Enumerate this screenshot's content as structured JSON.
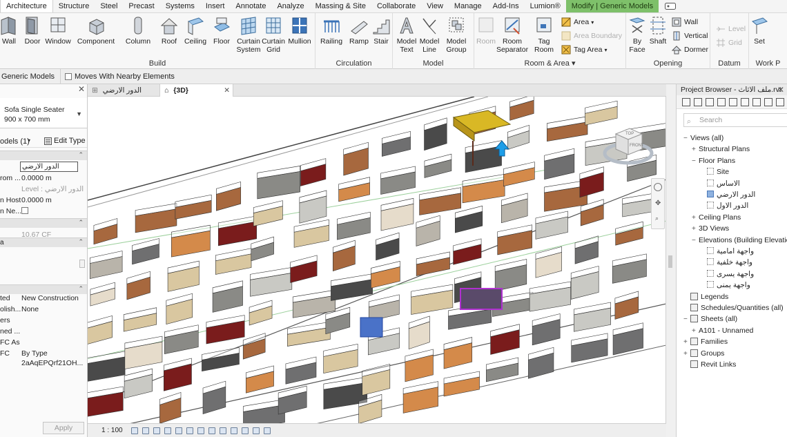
{
  "ribbon_tabs": [
    "Architecture",
    "Structure",
    "Steel",
    "Precast",
    "Systems",
    "Insert",
    "Annotate",
    "Analyze",
    "Massing & Site",
    "Collaborate",
    "View",
    "Manage",
    "Add-Ins",
    "Lumion®"
  ],
  "contextual_tab": "Modify | Generic Models",
  "panels": {
    "build": "Build",
    "circulation": "Circulation",
    "model": "Model",
    "room_area": "Room & Area ▾",
    "opening": "Opening",
    "datum": "Datum",
    "work_plane": "Work P"
  },
  "tools": {
    "wall": "Wall",
    "door": "Door",
    "window": "Window",
    "component": "Component",
    "column": "Column",
    "roof": "Roof",
    "ceiling": "Ceiling",
    "floor": "Floor",
    "curtain_system": "Curtain System",
    "curtain_grid": "Curtain Grid",
    "mullion": "Mullion",
    "railing": "Railing",
    "ramp": "Ramp",
    "stair": "Stair",
    "model_text": "Model Text",
    "model_line": "Model Line",
    "model_group": "Model Group",
    "room": "Room",
    "room_separator": "Room Separator",
    "tag_room": "Tag Room",
    "area": "Area",
    "area_boundary": "Area Boundary",
    "tag_area": "Tag Area",
    "by_face": "By Face",
    "shaft": "Shaft",
    "wall_opening": "Wall",
    "vertical": "Vertical",
    "dormer": "Dormer",
    "level": "Level",
    "grid": "Grid",
    "set": "Set"
  },
  "options_bar": {
    "context": "Generic Models",
    "moves_with_nearby": "Moves With Nearby Elements"
  },
  "properties": {
    "type_name": "Sofa Single Seater",
    "type_size": "900 x 700 mm",
    "instance_filter": "odels (1)",
    "edit_type": "Edit Type",
    "level_value": "الدور الارضي",
    "rows": [
      {
        "k": "rom ...",
        "v": "0.0000 m"
      },
      {
        "k": "",
        "v": "Level : الدور الارضي"
      },
      {
        "k": "n Host",
        "v": "0.0000 m"
      },
      {
        "k": "n Ne...",
        "v": ""
      }
    ],
    "volume": "10.67 CF",
    "phase_created_k": "ted",
    "phase_created_v": "New Construction",
    "phase_demo_k": "olish...",
    "phase_demo_v": "None",
    "ifc_k": "ers",
    "ifc_row2_k": "ned ...",
    "ifc_row3_k": "FC As",
    "ifc_row4_k": "FC",
    "ifc_row4_v": "By Type",
    "ifc_guid": "2aAqEPQrf21OH...",
    "group_a": "a",
    "apply": "Apply"
  },
  "view_tabs": [
    {
      "label": "الدور الارضي"
    },
    {
      "label": "{3D}"
    }
  ],
  "view_scale": "1 : 100",
  "browser": {
    "title": "Project Browser - ملف الاثاث.rvt",
    "search_placeholder": "Search",
    "tree": [
      {
        "label": "Views (all)",
        "level": 0,
        "toggle": "−"
      },
      {
        "label": "Structural Plans",
        "level": 1,
        "toggle": "+"
      },
      {
        "label": "Floor Plans",
        "level": 1,
        "toggle": "−"
      },
      {
        "label": "Site",
        "level": 2,
        "box": true
      },
      {
        "label": "الاساس",
        "level": 2,
        "box": true,
        "rtl": true
      },
      {
        "label": "الدور الارضي",
        "level": 2,
        "box": true,
        "rtl": true,
        "selected": true
      },
      {
        "label": "الدور الاول",
        "level": 2,
        "box": true,
        "rtl": true
      },
      {
        "label": "Ceiling Plans",
        "level": 1,
        "toggle": "+"
      },
      {
        "label": "3D Views",
        "level": 1,
        "toggle": "+"
      },
      {
        "label": "Elevations (Building Elevation)",
        "level": 1,
        "toggle": "−"
      },
      {
        "label": "واجهة امامية",
        "level": 2,
        "box": true,
        "rtl": true
      },
      {
        "label": "واجهة خلفية",
        "level": 2,
        "box": true,
        "rtl": true
      },
      {
        "label": "واجهة يسرى",
        "level": 2,
        "box": true,
        "rtl": true
      },
      {
        "label": "واجهة يمنى",
        "level": 2,
        "box": true,
        "rtl": true
      },
      {
        "label": "Legends",
        "level": 0,
        "icon": true
      },
      {
        "label": "Schedules/Quantities (all)",
        "level": 0,
        "icon": true
      },
      {
        "label": "Sheets (all)",
        "level": 0,
        "toggle": "−",
        "icon": true
      },
      {
        "label": "A101 - Unnamed",
        "level": 1,
        "toggle": "+"
      },
      {
        "label": "Families",
        "level": 0,
        "toggle": "+",
        "icon": true
      },
      {
        "label": "Groups",
        "level": 0,
        "toggle": "+",
        "icon": true
      },
      {
        "label": "Revit Links",
        "level": 0,
        "icon": true
      }
    ]
  },
  "viewcube": {
    "top": "TOP",
    "front": "FRONT"
  },
  "colors": {
    "contextual_tab": "#7ec06a",
    "accent_blue": "#3b7fd4",
    "selection_blue": "#8fb2e0"
  }
}
